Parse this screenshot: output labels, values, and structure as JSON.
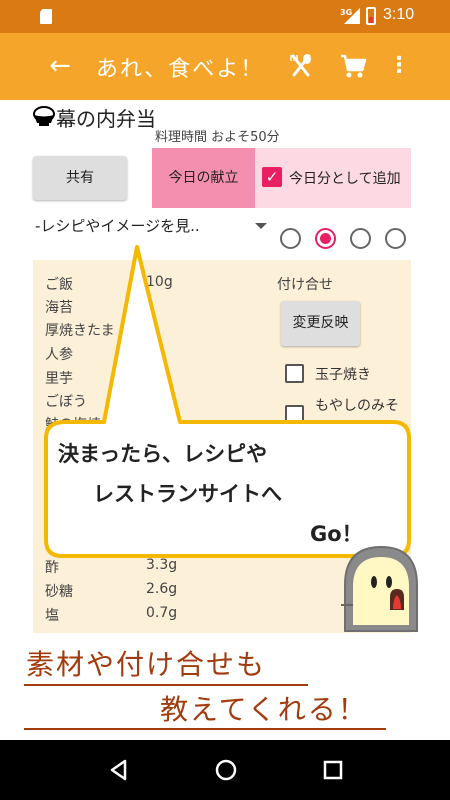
{
  "status_bar": {
    "network": "3G",
    "time": "3:10"
  },
  "app_bar": {
    "title": "あれ、食べよ！",
    "back_icon": "arrow-back-icon",
    "utensils_icon": "fork-spoon-icon",
    "cart_icon": "cart-icon",
    "more_icon": "more-vert-icon",
    "color": "#f5a62a"
  },
  "recipe": {
    "title": "幕の内弁当",
    "cook_time": "料理時間 およそ50分",
    "share_label": "共有",
    "today_menu_label": "今日の献立",
    "add_today_label": "今日分として追加",
    "add_today_checked": true,
    "dropdown_value": "-レシピやイメージを見..",
    "radios": [
      false,
      true,
      false,
      false
    ]
  },
  "ingredients": [
    {
      "name": "ご飯",
      "amount": "10g"
    },
    {
      "name": "海苔",
      "amount": ""
    },
    {
      "name": "厚焼きたま",
      "amount": ""
    },
    {
      "name": "人参",
      "amount": ""
    },
    {
      "name": "里芋",
      "amount": ""
    },
    {
      "name": "ごぼう",
      "amount": ""
    },
    {
      "name": "鮭の塩焼",
      "amount": ""
    },
    {
      "name": "酢",
      "amount": "3.3g"
    },
    {
      "name": "砂糖",
      "amount": "2.6g"
    },
    {
      "name": "塩",
      "amount": "0.7g"
    }
  ],
  "side_dishes": {
    "label": "付け合せ",
    "apply_label": "変更反映",
    "items": [
      "玉子焼き",
      "もやしのみそ"
    ]
  },
  "bubble": {
    "line1": "決まったら、レシピや",
    "line2": "レストランサイトへ",
    "line3": "Go！"
  },
  "promo": {
    "line1": "素材や付け合せも",
    "line2": "教えてくれる！"
  },
  "colors": {
    "status_bar": "#d97a13",
    "accent": "#e91e63",
    "panel": "#fdf0d8",
    "promo_text": "#a23c0e",
    "bubble_border": "#f5b800"
  }
}
